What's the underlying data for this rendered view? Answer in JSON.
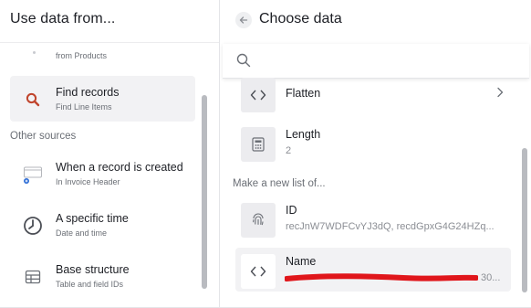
{
  "left_panel": {
    "title": "Use data from...",
    "cut_item_sub": "from Products",
    "selected_item": {
      "label": "Find records",
      "sub": "Find Line Items",
      "icon": "search-icon",
      "accent": "#c0442c"
    },
    "section_label": "Other sources",
    "items": [
      {
        "label": "When a record is created",
        "sub": "In Invoice Header",
        "icon": "record-created-icon"
      },
      {
        "label": "A specific time",
        "sub": "Date and time",
        "icon": "clock-icon"
      },
      {
        "label": "Base structure",
        "sub": "Table and field IDs",
        "icon": "table-icon"
      }
    ]
  },
  "right_panel": {
    "title": "Choose data",
    "search": {
      "placeholder": "",
      "value": ""
    },
    "fields_top": [
      {
        "label": "Flatten",
        "value": "",
        "icon": "code-brackets-icon"
      },
      {
        "label": "Length",
        "value": "2",
        "icon": "calculator-icon"
      }
    ],
    "make_list_label": "Make a new list of...",
    "fields_list": [
      {
        "label": "ID",
        "value": "recJnW7WDFCvYJ3dQ, recdGpxG4G24HZq...",
        "icon": "fingerprint-icon"
      },
      {
        "label": "Name",
        "value": "30...",
        "icon": "code-brackets-icon"
      }
    ]
  },
  "colors": {
    "accent": "#c0442c",
    "redaction": "#e0161b",
    "selected_bg": "#f2f2f4"
  }
}
